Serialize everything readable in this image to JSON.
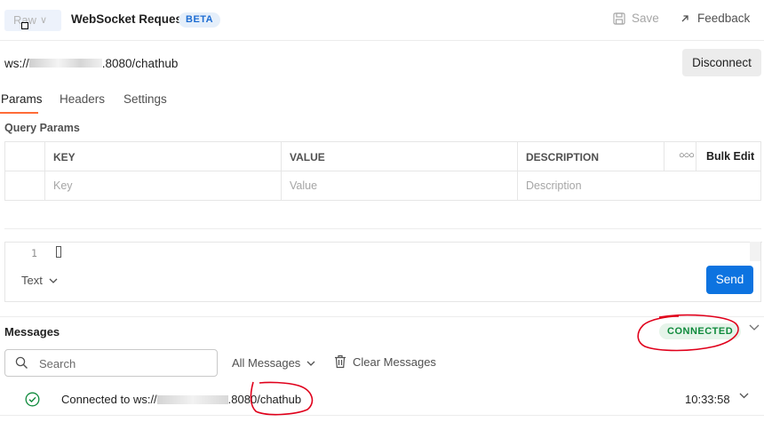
{
  "header": {
    "message_type": "Raw",
    "title": "WebSocket Request",
    "beta_badge": "BETA",
    "save_label": "Save",
    "feedback_label": "Feedback"
  },
  "url_bar": {
    "url_prefix": "ws://",
    "url_suffix": ".8080/chathub",
    "disconnect_label": "Disconnect"
  },
  "tabs": [
    {
      "label": "Params",
      "active": true
    },
    {
      "label": "Headers",
      "active": false
    },
    {
      "label": "Settings",
      "active": false
    }
  ],
  "query_params": {
    "label": "Query Params",
    "columns": [
      "KEY",
      "VALUE",
      "DESCRIPTION"
    ],
    "bulk_edit_label": "Bulk Edit",
    "placeholders": {
      "key": "Key",
      "value": "Value",
      "description": "Description"
    }
  },
  "composer": {
    "line_number": "1",
    "format_label": "Text",
    "send_label": "Send"
  },
  "messages": {
    "title": "Messages",
    "status": "CONNECTED",
    "status_color": "#0f8a3c",
    "search_placeholder": "Search",
    "filter_label": "All Messages",
    "clear_label": "Clear Messages",
    "items": [
      {
        "text_prefix": "Connected to ws://",
        "text_suffix": ".8080/chathub",
        "time": "10:33:58",
        "icon": "check-circle-icon"
      }
    ]
  },
  "colors": {
    "accent_tab": "#ff6c37",
    "send_button": "#0d73e0",
    "annotation": "#e0001b"
  }
}
